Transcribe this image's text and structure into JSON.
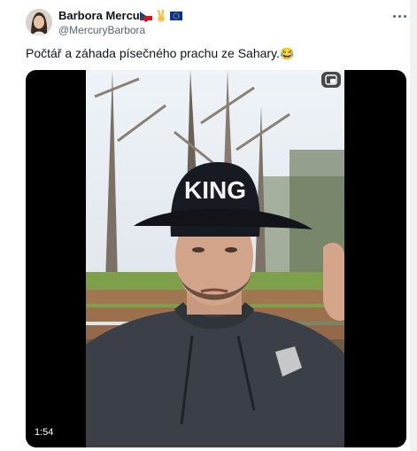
{
  "author": {
    "display_name": "Barbora Mercury",
    "handle": "@MercuryBarbora",
    "badges": [
      "czech-flag-icon",
      "victory-hand-icon",
      "eu-flag-icon"
    ]
  },
  "post": {
    "text": "Počtář a záhada písečného prachu ze Sahary.",
    "emoji": "😂"
  },
  "video": {
    "duration": "1:54",
    "cap_text": "KING"
  },
  "colors": {
    "text": "#0f1419",
    "secondary": "#536471",
    "media_background": "#000000"
  }
}
